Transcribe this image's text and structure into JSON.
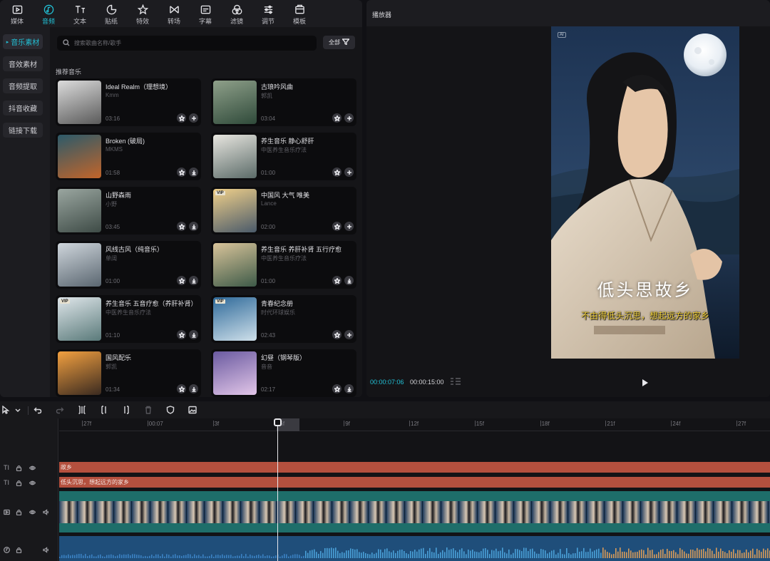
{
  "toolbar": {
    "items": [
      {
        "label": "媒体",
        "icon": "media-icon",
        "active": false
      },
      {
        "label": "音频",
        "icon": "audio-icon",
        "active": true
      },
      {
        "label": "文本",
        "icon": "text-icon",
        "active": false
      },
      {
        "label": "贴纸",
        "icon": "sticker-icon",
        "active": false
      },
      {
        "label": "特效",
        "icon": "effects-icon",
        "active": false
      },
      {
        "label": "转场",
        "icon": "transition-icon",
        "active": false
      },
      {
        "label": "字幕",
        "icon": "subtitle-icon",
        "active": false
      },
      {
        "label": "滤镜",
        "icon": "filter-icon",
        "active": false
      },
      {
        "label": "调节",
        "icon": "adjust-icon",
        "active": false
      },
      {
        "label": "模板",
        "icon": "template-icon",
        "active": false
      }
    ]
  },
  "sidebar": {
    "items": [
      {
        "label": "音乐素材",
        "active": true
      },
      {
        "label": "音效素材",
        "active": false
      },
      {
        "label": "音频提取",
        "active": false
      },
      {
        "label": "抖音收藏",
        "active": false
      },
      {
        "label": "链接下载",
        "active": false
      }
    ]
  },
  "search": {
    "placeholder": "搜索歌曲名称/歌手"
  },
  "filter": {
    "label": "全部"
  },
  "section": {
    "title": "推荐音乐"
  },
  "music": [
    {
      "title": "Ideal Realm（理想境）",
      "artist": "Kmm",
      "duration": "03:16",
      "vip": false,
      "action": "add"
    },
    {
      "title": "古琅吟风曲",
      "artist": "郭凯",
      "duration": "03:04",
      "vip": false,
      "action": "add"
    },
    {
      "title": "Broken (破局)",
      "artist": "MKMS",
      "duration": "01:58",
      "vip": false,
      "action": "download"
    },
    {
      "title": "养生音乐 静心舒肝",
      "artist": "中医养生音乐疗法",
      "duration": "01:00",
      "vip": false,
      "action": "add"
    },
    {
      "title": "山野森雨",
      "artist": "小野",
      "duration": "03:45",
      "vip": false,
      "action": "download"
    },
    {
      "title": "中国风 大气 唯美",
      "artist": "Lance",
      "duration": "02:00",
      "vip": true,
      "action": "add"
    },
    {
      "title": "风线古风（纯音乐）",
      "artist": "单阔",
      "duration": "01:00",
      "vip": false,
      "action": "download"
    },
    {
      "title": "养生音乐 养肝补肾 五行疗愈",
      "artist": "中医养生音乐疗法",
      "duration": "01:00",
      "vip": false,
      "action": "download"
    },
    {
      "title": "养生音乐 五音疗愈（养肝补肾）",
      "artist": "中医养生音乐疗法",
      "duration": "01:10",
      "vip": true,
      "action": "download"
    },
    {
      "title": "青春纪念册",
      "artist": "时代环球娱乐",
      "duration": "02:43",
      "vip": true,
      "action": "add"
    },
    {
      "title": "国风配乐",
      "artist": "郭凯",
      "duration": "01:34",
      "vip": false,
      "action": "download"
    },
    {
      "title": "幻昼（钢琴版）",
      "artist": "音音",
      "duration": "02:17",
      "vip": false,
      "action": "download"
    }
  ],
  "thumb_colors": [
    [
      "#dcdcdc",
      "#5a5a5a"
    ],
    [
      "#8fa08a",
      "#2f4a3a"
    ],
    [
      "#2c5a6a",
      "#c2652a"
    ],
    [
      "#e8e6e0",
      "#5b6b68"
    ],
    [
      "#9aa6a0",
      "#3e4b46"
    ],
    [
      "#f0d08a",
      "#4a5a6a"
    ],
    [
      "#cfd6dc",
      "#5a6670"
    ],
    [
      "#d9c49a",
      "#3d5a48"
    ],
    [
      "#dfe6ea",
      "#5a7a7a"
    ],
    [
      "#2f6a9a",
      "#cfe0ea"
    ],
    [
      "#f2a040",
      "#3a2a20"
    ],
    [
      "#6a5aa0",
      "#e2c6e8"
    ]
  ],
  "player": {
    "title": "播放器",
    "ai_badge": "AI",
    "subtitle_main": "低头思故乡",
    "subtitle_secondary": "不由得低头沉思，想起远方的家乡",
    "current_time": "00:00:07:06",
    "total_time": "00:00:15:00"
  },
  "timeline": {
    "ruler_ticks": [
      "27f",
      "00:07",
      "3f",
      "6f",
      "9f",
      "12f",
      "15f",
      "18f",
      "21f",
      "24f",
      "27f"
    ],
    "text_clip_1": "故乡",
    "text_clip_2": "低头沉思，想起远方的家乡",
    "track_types": [
      "TI",
      "TI"
    ]
  },
  "colors": {
    "accent": "#22c1d6",
    "text_clip": "#b4503e",
    "video_clip": "#1e6e6a",
    "audio_clip": "#1f4e7a"
  }
}
